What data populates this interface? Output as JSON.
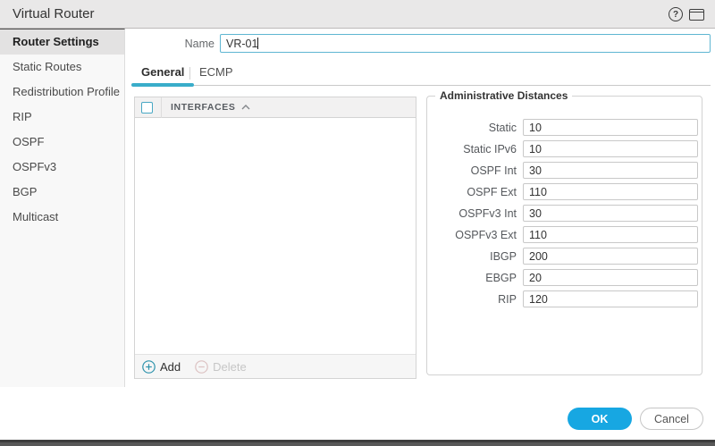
{
  "window": {
    "title": "Virtual Router"
  },
  "icons": {
    "help": "?",
    "window": "window-frame",
    "sort_asc": "chevron-up",
    "add": "circle-plus",
    "delete": "circle-minus"
  },
  "sidebar": {
    "items": [
      {
        "label": "Router Settings",
        "selected": true
      },
      {
        "label": "Static Routes",
        "selected": false
      },
      {
        "label": "Redistribution Profile",
        "selected": false
      },
      {
        "label": "RIP",
        "selected": false
      },
      {
        "label": "OSPF",
        "selected": false
      },
      {
        "label": "OSPFv3",
        "selected": false
      },
      {
        "label": "BGP",
        "selected": false
      },
      {
        "label": "Multicast",
        "selected": false
      }
    ]
  },
  "form": {
    "name_label": "Name",
    "name_value": "VR-01"
  },
  "tabs": [
    {
      "label": "General",
      "active": true
    },
    {
      "label": "ECMP",
      "active": false
    }
  ],
  "interfaces_table": {
    "column_header": "INTERFACES",
    "rows": [],
    "add_label": "Add",
    "delete_label": "Delete",
    "delete_enabled": false
  },
  "admin_distances": {
    "legend": "Administrative Distances",
    "fields": [
      {
        "label": "Static",
        "value": "10"
      },
      {
        "label": "Static IPv6",
        "value": "10"
      },
      {
        "label": "OSPF Int",
        "value": "30"
      },
      {
        "label": "OSPF Ext",
        "value": "110"
      },
      {
        "label": "OSPFv3 Int",
        "value": "30"
      },
      {
        "label": "OSPFv3 Ext",
        "value": "110"
      },
      {
        "label": "IBGP",
        "value": "200"
      },
      {
        "label": "EBGP",
        "value": "20"
      },
      {
        "label": "RIP",
        "value": "120"
      }
    ]
  },
  "footer": {
    "ok_label": "OK",
    "cancel_label": "Cancel"
  },
  "colors": {
    "accent_blue": "#17a7e2",
    "tab_underline_teal": "#39adca",
    "checkbox_border": "#49a8c4",
    "selected_item_bg": "#e3e2e2",
    "titlebar_bg": "#e9e8e8"
  }
}
